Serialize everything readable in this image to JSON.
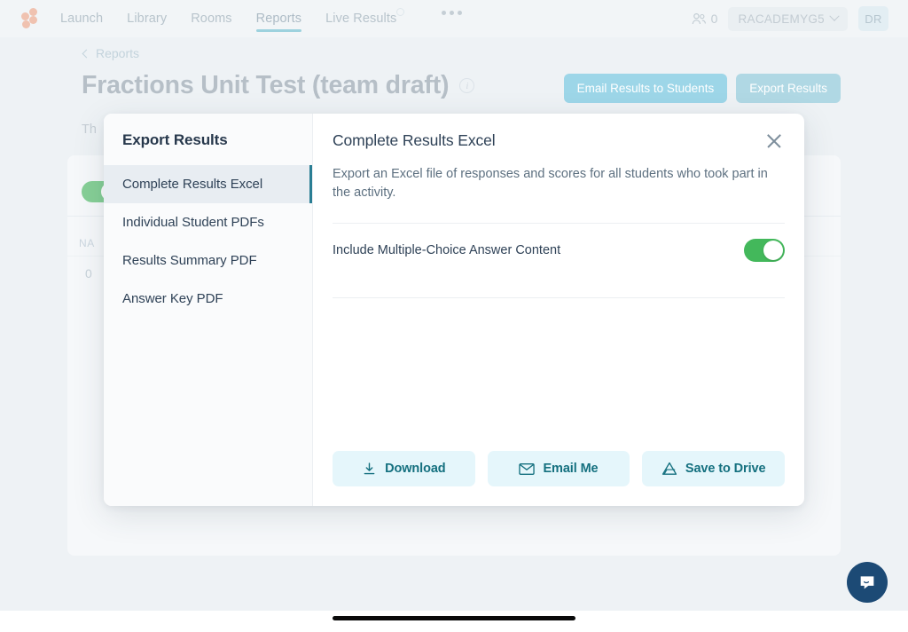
{
  "app": {
    "logo_name": "logo-dots"
  },
  "nav": {
    "items": [
      {
        "label": "Launch",
        "active": false
      },
      {
        "label": "Library",
        "active": false
      },
      {
        "label": "Rooms",
        "active": false
      },
      {
        "label": "Reports",
        "active": true
      },
      {
        "label": "Live Results",
        "active": false
      }
    ],
    "overflow_icon": "ellipsis-icon",
    "people_count": "0",
    "org_name": "RACADEMYG5",
    "avatar_initials": "DR"
  },
  "breadcrumb": {
    "back_label": "Reports"
  },
  "header": {
    "title": "Fractions Unit Test (team draft)",
    "info_glyph": "i",
    "description": "Th",
    "actions": [
      {
        "label": "Email Results to Students"
      },
      {
        "label": "Export Results"
      }
    ]
  },
  "background_table": {
    "column_header": "NA",
    "first_cell": "0"
  },
  "modal": {
    "sidebar": {
      "title": "Export Results",
      "items": [
        {
          "label": "Complete Results Excel",
          "active": true
        },
        {
          "label": "Individual Student PDFs",
          "active": false
        },
        {
          "label": "Results Summary PDF",
          "active": false
        },
        {
          "label": "Answer Key PDF",
          "active": false
        }
      ]
    },
    "panel": {
      "title": "Complete Results Excel",
      "description": "Export an Excel file of responses and scores for all students who took part in the activity.",
      "close_label": "Close",
      "options": [
        {
          "label": "Include Multiple-Choice Answer Content",
          "value": "on"
        }
      ],
      "actions": [
        {
          "label": "Download",
          "icon": "download-icon"
        },
        {
          "label": "Email Me",
          "icon": "envelope-icon"
        },
        {
          "label": "Save to Drive",
          "icon": "google-drive-icon"
        }
      ]
    }
  },
  "support": {
    "chat_label": "Open chat"
  },
  "colors": {
    "accent_teal": "#14707f",
    "toggle_green": "#43b85b",
    "header_button": "#9dd6e8",
    "selected_indicator": "#2a7e94",
    "intercom": "#1c4a75"
  }
}
